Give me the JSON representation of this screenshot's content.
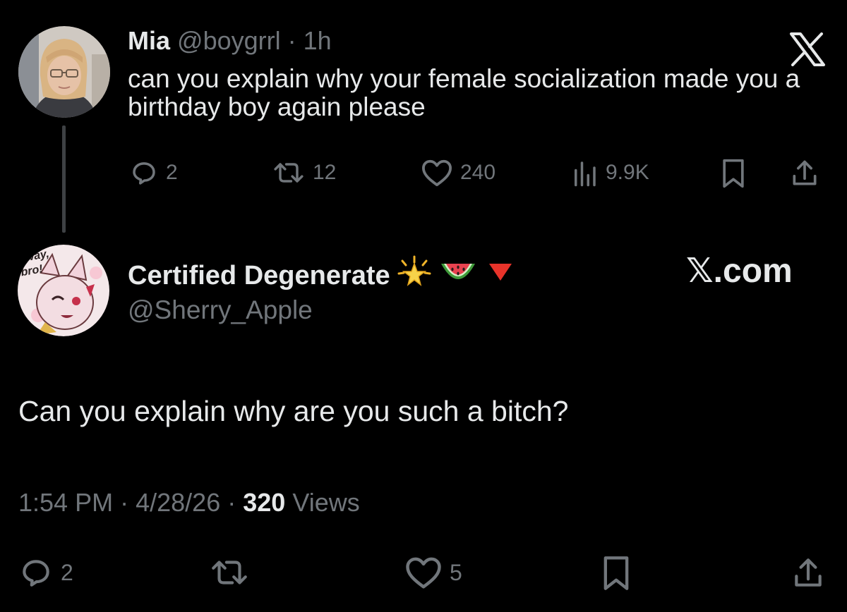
{
  "parent_tweet": {
    "name": "Mia",
    "handle": "@boygrrl",
    "separator": "·",
    "time": "1h",
    "text": "can you explain why your female socialization made you a birthday boy again please",
    "actions": {
      "replies": "2",
      "retweets": "12",
      "likes": "240",
      "views": "9.9K"
    }
  },
  "reply_tweet": {
    "name": "Certified Degenerate",
    "name_emojis": [
      "star-emoji",
      "watermelon-emoji",
      "red-triangle-emoji"
    ],
    "handle": "@Sherry_Apple",
    "avatar_text": "o way, bro!",
    "watermark": "𝕏.com",
    "text": "Can you explain why are you such a bitch?",
    "meta": {
      "time": "1:54 PM",
      "separator": "·",
      "date": "4/28/26",
      "views_count": "320",
      "views_label": "Views"
    },
    "actions": {
      "replies": "2",
      "likes": "5"
    }
  },
  "icons": {
    "reply": "reply-icon",
    "retweet": "retweet-icon",
    "like": "heart-icon",
    "views": "views-icon",
    "bookmark": "bookmark-icon",
    "share": "share-icon",
    "x_logo": "x-logo-icon"
  },
  "colors": {
    "background": "#000000",
    "text": "#e7e9ea",
    "muted": "#71767b"
  }
}
